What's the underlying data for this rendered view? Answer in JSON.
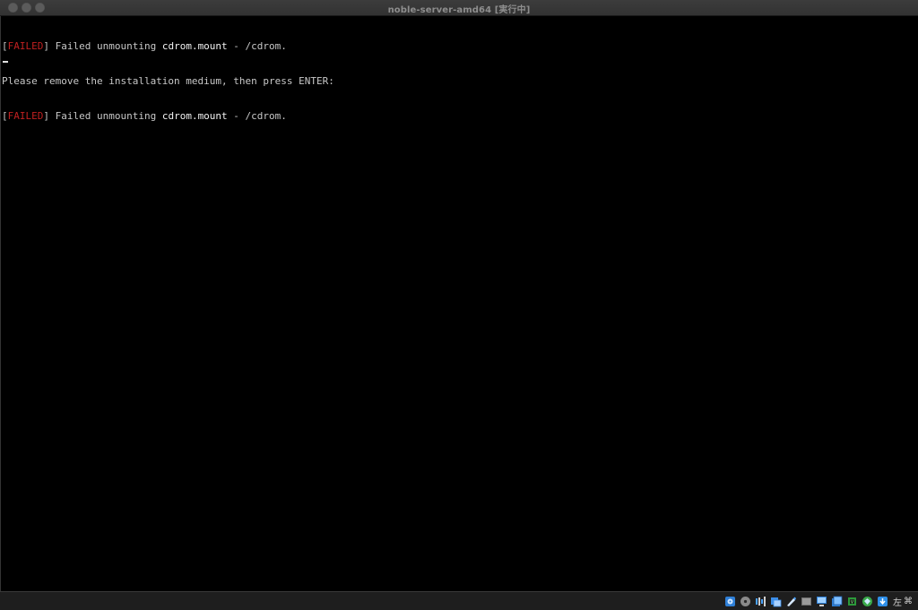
{
  "window": {
    "title": "noble-server-amd64 [実行中]"
  },
  "terminal": {
    "lines": [
      {
        "open": "[",
        "status": "FAILED",
        "close": "] Failed unmounting ",
        "unit": "cdrom.mount",
        "rest": " - /cdrom."
      },
      {
        "text": "Please remove the installation medium, then press ENTER:"
      },
      {
        "open": "[",
        "status": "FAILED",
        "close": "] Failed unmounting ",
        "unit": "cdrom.mount",
        "rest": " - /cdrom."
      }
    ]
  },
  "statusbar": {
    "icons": [
      "hard-disk-icon",
      "optical-drive-icon",
      "audio-icon",
      "network-icon",
      "usb-icon",
      "shared-folders-icon",
      "display-icon",
      "video-capture-icon",
      "cpu-icon",
      "mouse-integration-icon",
      "download-icon"
    ],
    "host_key_label": "左",
    "host_key_symbol": "⌘"
  },
  "colors": {
    "failed": "#c02020",
    "text": "#c8c8c8",
    "background": "#000000"
  }
}
